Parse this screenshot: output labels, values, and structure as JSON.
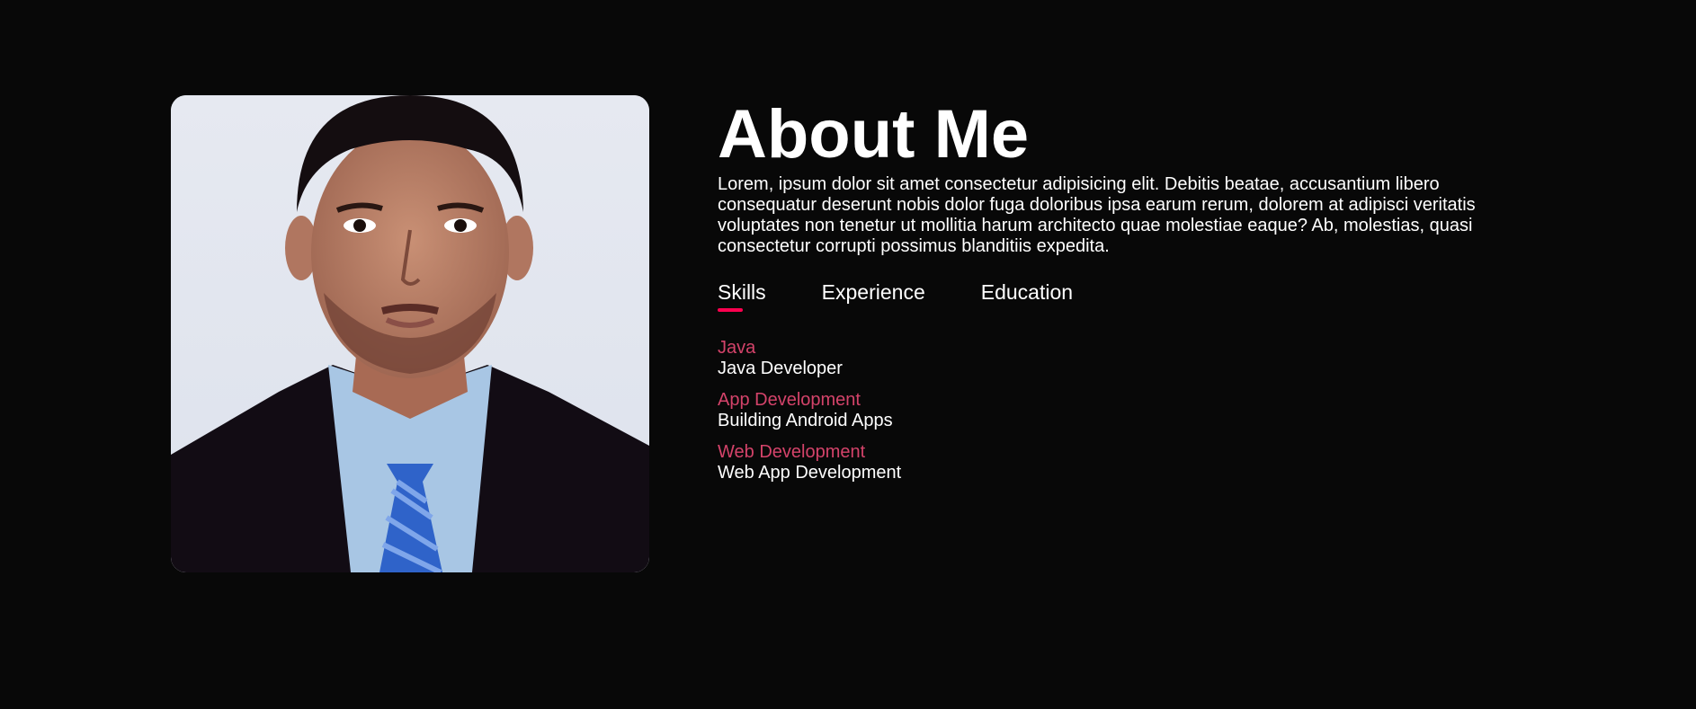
{
  "about": {
    "title": "About Me",
    "description": "Lorem, ipsum dolor sit amet consectetur adipisicing elit. Debitis beatae, accusantium libero consequatur deserunt nobis dolor fuga doloribus ipsa earum rerum, dolorem at adipisci veritatis voluptates non tenetur ut mollitia harum architecto quae molestiae eaque? Ab, molestias, quasi consectetur corrupti possimus blanditiis expedita."
  },
  "tabs": [
    {
      "label": "Skills",
      "active": true
    },
    {
      "label": "Experience",
      "active": false
    },
    {
      "label": "Education",
      "active": false
    }
  ],
  "skills": [
    {
      "name": "Java",
      "detail": "Java Developer"
    },
    {
      "name": "App Development",
      "detail": "Building Android Apps"
    },
    {
      "name": "Web Development",
      "detail": "Web App Development"
    }
  ],
  "colors": {
    "background": "#080808",
    "accent": "#ff004f",
    "skill_name": "#d4436a",
    "text": "#ffffff"
  },
  "icons": {
    "profile_photo": "profile-photo"
  }
}
